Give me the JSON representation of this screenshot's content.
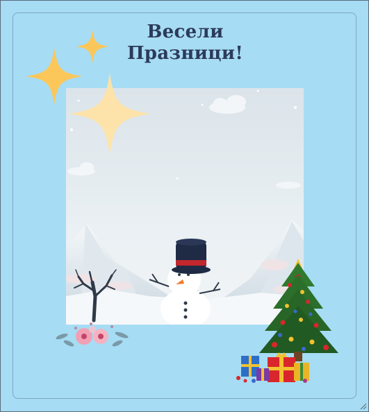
{
  "greeting": {
    "line1": "Весели",
    "line2": "Празници!"
  },
  "colors": {
    "background": "#a6dcf4",
    "title": "#2c3a5a",
    "star": "#fcc75a",
    "star_light": "#ffe3a4"
  },
  "icons": {
    "stars": "four-point-star-icon",
    "snowman": "snowman-icon",
    "tree": "christmas-tree-icon",
    "gifts": "gift-boxes-icon",
    "flowers": "flower-bouquet-icon"
  }
}
